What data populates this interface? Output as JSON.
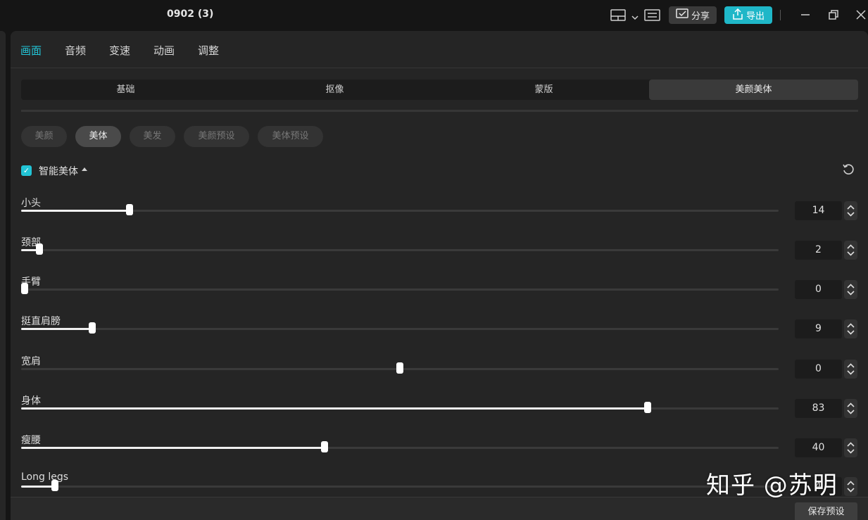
{
  "window": {
    "title": "0902 (3)",
    "share_label": "分享",
    "export_label": "导出",
    "accent_color": "#22c4d6"
  },
  "top_tabs": [
    "画面",
    "音频",
    "变速",
    "动画",
    "调整"
  ],
  "sub_tabs": [
    "基础",
    "抠像",
    "蒙版",
    "美颜美体"
  ],
  "pills": [
    "美颜",
    "美体",
    "美发",
    "美颜预设",
    "美体预设"
  ],
  "smart_body": {
    "label": "智能美体",
    "checked": true
  },
  "sliders": [
    {
      "label": "小头",
      "value": "14"
    },
    {
      "label": "颈部",
      "value": "2"
    },
    {
      "label": "手臂",
      "value": "0"
    },
    {
      "label": "挺直肩膀",
      "value": "9"
    },
    {
      "label": "宽肩",
      "value": "0"
    },
    {
      "label": "身体",
      "value": "83"
    },
    {
      "label": "瘦腰",
      "value": "40"
    },
    {
      "label": "Long legs",
      "value": "4"
    }
  ],
  "footer": {
    "save_preset_label": "保存预设"
  },
  "watermark": "知乎 @苏明"
}
